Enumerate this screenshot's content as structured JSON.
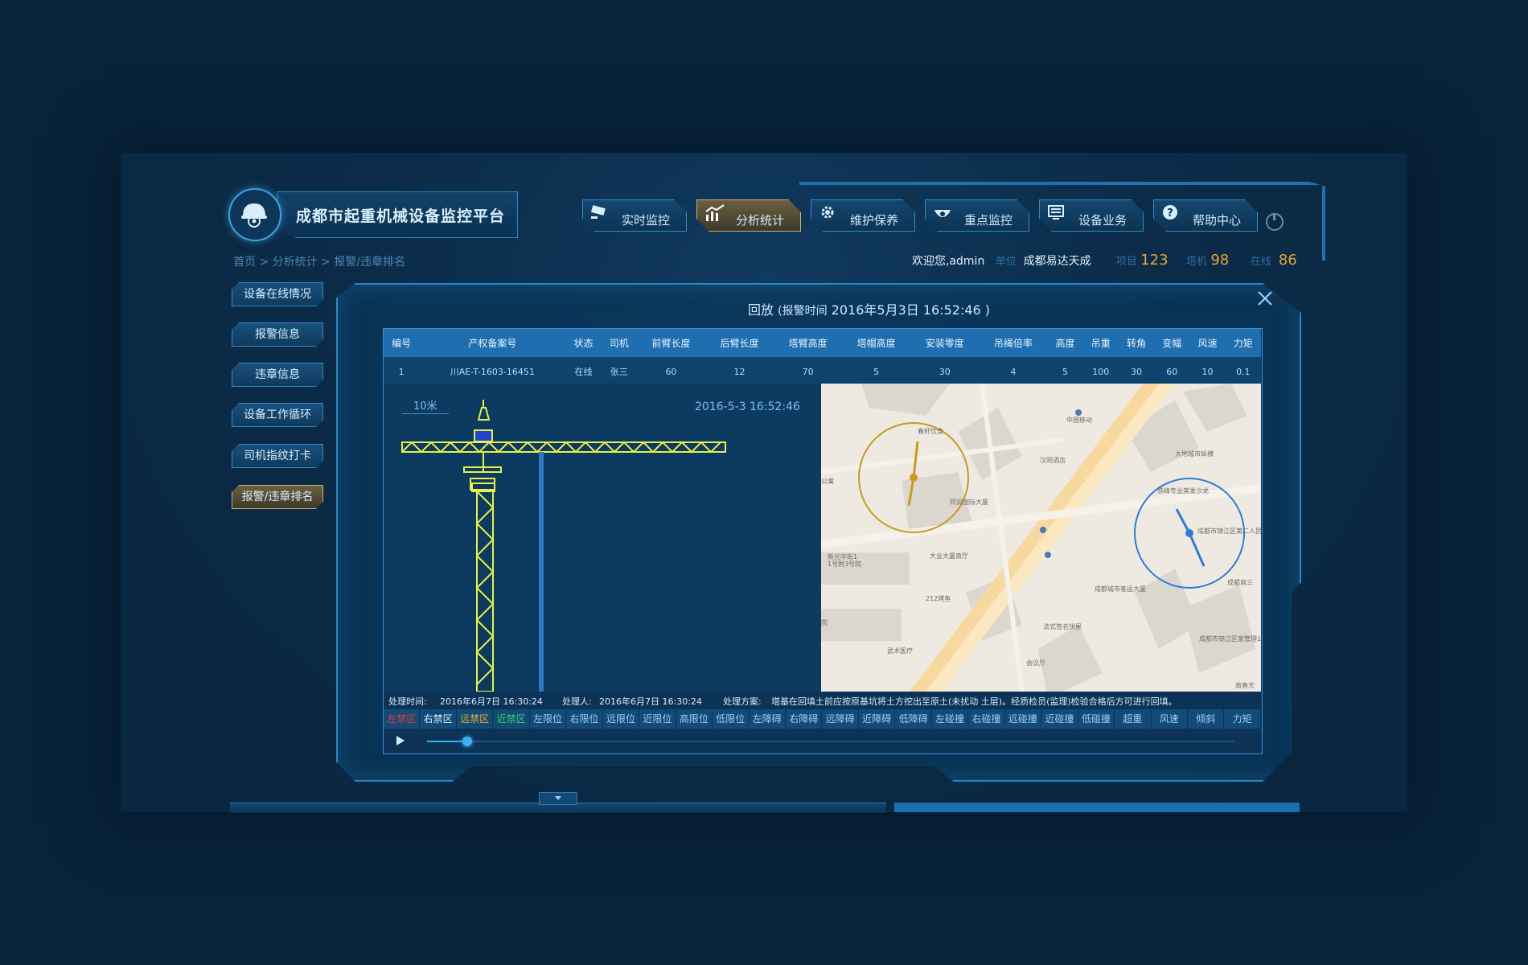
{
  "app": {
    "title": "成都市起重机械设备监控平台"
  },
  "nav": [
    {
      "label": "实时监控",
      "icon": "camera-icon",
      "active": false
    },
    {
      "label": "分析统计",
      "icon": "chart-icon",
      "active": true
    },
    {
      "label": "维护保养",
      "icon": "gear-icon",
      "active": false
    },
    {
      "label": "重点监控",
      "icon": "dome-camera-icon",
      "active": false
    },
    {
      "label": "设备业务",
      "icon": "monitor-icon",
      "active": false
    },
    {
      "label": "帮助中心",
      "icon": "help-icon",
      "active": false
    }
  ],
  "breadcrumb": "首页 > 分析统计 > 报警/违章排名",
  "status": {
    "welcome": "欢迎您,admin",
    "unit_label": "单位",
    "unit": "成都易达天成",
    "project_label": "项目",
    "project": "123",
    "crane_label": "塔机",
    "crane": "98",
    "online_label": "在线",
    "online": "86"
  },
  "sidebar": [
    {
      "label": "设备在线情况",
      "active": false
    },
    {
      "label": "报警信息",
      "active": false
    },
    {
      "label": "违章信息",
      "active": false
    },
    {
      "label": "设备工作循环",
      "active": false
    },
    {
      "label": "司机指纹打卡",
      "active": false
    },
    {
      "label": "报警/违章排名",
      "active": true
    }
  ],
  "modal": {
    "title": "回放",
    "alarm_prefix": "(报警时间",
    "alarm_time": "2016年5月3日 16:52:46 )"
  },
  "table": {
    "headers": [
      "编号",
      "产权备案号",
      "状态",
      "司机",
      "前臂长度",
      "后臂长度",
      "塔臂高度",
      "塔帽高度",
      "安装零度",
      "吊绳倍率",
      "高度",
      "吊重",
      "转角",
      "变幅",
      "风速",
      "力矩"
    ],
    "row": [
      "1",
      "川AE-T-1603-16451",
      "在线",
      "张三",
      "60",
      "12",
      "70",
      "5",
      "30",
      "4",
      "5",
      "100",
      "30",
      "60",
      "10",
      "0.1"
    ]
  },
  "canvas": {
    "scale": "10米",
    "time": "2016-5-3 16:52:46"
  },
  "map": {
    "labels": [
      "中国移动",
      "春轩饮食",
      "汉阳酒店",
      "大地城市纵横",
      "同润国际大厦",
      "公寓",
      "新光华街1",
      "1号附3号院",
      "大业大厦南厅",
      "铁峰专业美发沙龙",
      "成都市锦江区第二人民医院分部",
      "成都城市客运大厦",
      "成都商三",
      "212烤鱼",
      "法式签名饼屋",
      "武术医疗",
      "成都市锦江区家管理公司",
      "会议厅",
      "南春天",
      "院"
    ]
  },
  "info": {
    "time_label": "处理时间:",
    "time": "2016年6月7日 16:30:24",
    "person_label": "处理人:",
    "person": "2016年6月7日 16:30:24",
    "plan_label": "处理方案:",
    "plan": "塔基在回填土前应按原基坑将土方挖出至原土(未扰动 土层)。经质检员(监理)检验合格后方可进行回填。"
  },
  "zones": [
    {
      "label": "左禁区",
      "color": "#e43a3a"
    },
    {
      "label": "右禁区",
      "color": "#d6ecff"
    },
    {
      "label": "远禁区",
      "color": "#e6a632"
    },
    {
      "label": "近禁区",
      "color": "#38d15a"
    },
    {
      "label": "左限位",
      "color": "#9ad0f8"
    },
    {
      "label": "右限位",
      "color": "#9ad0f8"
    },
    {
      "label": "远限位",
      "color": "#9ad0f8"
    },
    {
      "label": "近限位",
      "color": "#9ad0f8"
    },
    {
      "label": "高限位",
      "color": "#9ad0f8"
    },
    {
      "label": "低限位",
      "color": "#9ad0f8"
    },
    {
      "label": "左障碍",
      "color": "#9ad0f8"
    },
    {
      "label": "右障碍",
      "color": "#9ad0f8"
    },
    {
      "label": "远障碍",
      "color": "#9ad0f8"
    },
    {
      "label": "近障碍",
      "color": "#9ad0f8"
    },
    {
      "label": "低障碍",
      "color": "#9ad0f8"
    },
    {
      "label": "左碰撞",
      "color": "#9ad0f8"
    },
    {
      "label": "右碰撞",
      "color": "#9ad0f8"
    },
    {
      "label": "远碰撞",
      "color": "#9ad0f8"
    },
    {
      "label": "近碰撞",
      "color": "#9ad0f8"
    },
    {
      "label": "低碰撞",
      "color": "#9ad0f8"
    },
    {
      "label": "超重",
      "color": "#9ad0f8"
    },
    {
      "label": "风速",
      "color": "#9ad0f8"
    },
    {
      "label": "倾斜",
      "color": "#9ad0f8"
    },
    {
      "label": "力矩",
      "color": "#9ad0f8"
    }
  ],
  "player": {
    "progress": 0.05
  }
}
